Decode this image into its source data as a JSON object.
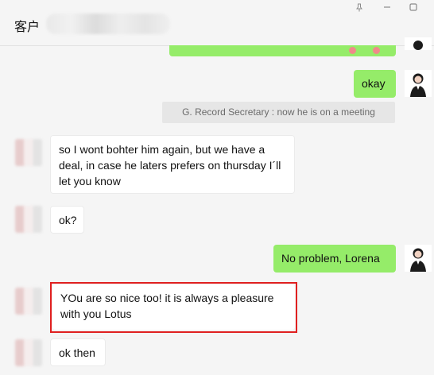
{
  "window": {
    "title": "客户",
    "buttons": {
      "pin": "pin-icon",
      "minimize": "minimize-icon",
      "maximize": "maximize-icon"
    }
  },
  "messages": [
    {
      "id": "m0",
      "side": "out",
      "text": ""
    },
    {
      "id": "m1",
      "side": "out",
      "text": "okay"
    },
    {
      "id": "m2",
      "side": "system",
      "text": "G. Record Secretary : now he is on a meeting"
    },
    {
      "id": "m3",
      "side": "in",
      "text": "so I wont bohter him again, but we have a deal, in case he laters prefers on thursday I´ll let you know"
    },
    {
      "id": "m4",
      "side": "in",
      "text": "ok?"
    },
    {
      "id": "m5",
      "side": "out",
      "text": "No problem, Lorena"
    },
    {
      "id": "m6",
      "side": "in",
      "text": "YOu are so nice too! it is always a pleasure with you Lotus",
      "highlighted": true
    },
    {
      "id": "m7",
      "side": "in",
      "text": "ok then"
    }
  ],
  "colors": {
    "outgoing_bubble": "#95ec69",
    "incoming_bubble": "#ffffff",
    "highlight_border": "#e02020",
    "background": "#f5f5f5"
  }
}
